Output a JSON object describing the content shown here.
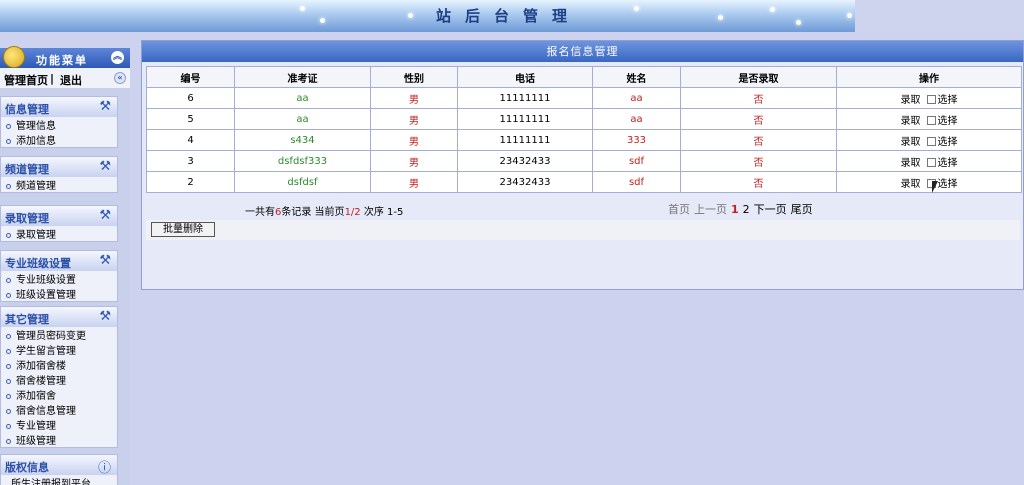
{
  "banner": {
    "title": "站后台管理"
  },
  "sidebar": {
    "header_title": "功能菜单",
    "nav": {
      "home": "管理首页",
      "separator": "|",
      "logout": "退出"
    },
    "groups": [
      {
        "title": "信息管理",
        "items": [
          "管理信息",
          "添加信息"
        ]
      },
      {
        "title": "频道管理",
        "items": [
          "频道管理"
        ]
      },
      {
        "title": "录取管理",
        "items": [
          "录取管理"
        ]
      },
      {
        "title": "专业班级设置",
        "items": [
          "专业班级设置",
          "班级设置管理"
        ]
      },
      {
        "title": "其它管理",
        "items": [
          "管理员密码变更",
          "学生留言管理",
          "添加宿舍楼",
          "宿舍楼管理",
          "添加宿舍",
          "宿舍信息管理",
          "专业管理",
          "班级管理"
        ]
      },
      {
        "title": "版权信息",
        "items": [
          "所生注册报到平台"
        ]
      }
    ]
  },
  "main": {
    "title": "报名信息管理",
    "columns": [
      "编号",
      "准考证",
      "性别",
      "电话",
      "姓名",
      "是否录取",
      "操作"
    ],
    "rows": [
      {
        "id": "6",
        "ticket": "aa",
        "gender": "男",
        "phone": "11111111",
        "name": "aa",
        "admitted": "否",
        "action": "录取",
        "select": "选择"
      },
      {
        "id": "5",
        "ticket": "aa",
        "gender": "男",
        "phone": "11111111",
        "name": "aa",
        "admitted": "否",
        "action": "录取",
        "select": "选择"
      },
      {
        "id": "4",
        "ticket": "s434",
        "gender": "男",
        "phone": "11111111",
        "name": "333",
        "admitted": "否",
        "action": "录取",
        "select": "选择"
      },
      {
        "id": "3",
        "ticket": "dsfdsf333",
        "gender": "男",
        "phone": "23432433",
        "name": "sdf",
        "admitted": "否",
        "action": "录取",
        "select": "选择"
      },
      {
        "id": "2",
        "ticket": "dsfdsf",
        "gender": "男",
        "phone": "23432433",
        "name": "sdf",
        "admitted": "否",
        "action": "录取",
        "select": "选择"
      }
    ],
    "pager": {
      "prefix": "一共有",
      "total": "6",
      "mid": "条记录 当前页",
      "current": "1/2",
      "order_label": "次序",
      "range": "1-5",
      "first": "首页",
      "prev": "上一页",
      "page1": "1",
      "page2": "2",
      "next": "下一页",
      "last": "尾页"
    },
    "bulk_delete": "批量删除"
  },
  "colors": {
    "header_blue": "#3867c3",
    "red": "#c42020",
    "green": "#2d8a2d"
  }
}
